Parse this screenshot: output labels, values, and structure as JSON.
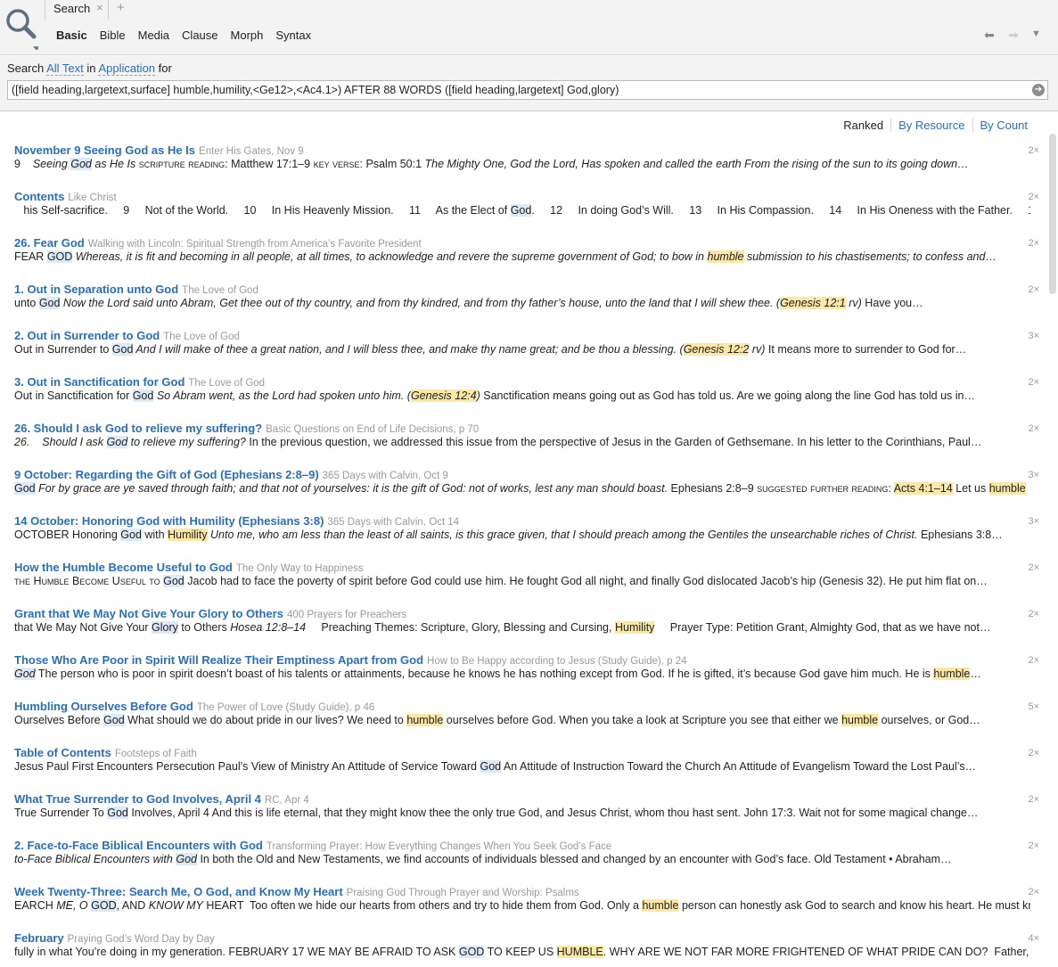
{
  "header": {
    "tab_label": "Search",
    "tab_close": "×",
    "tab_add": "+",
    "modes": [
      "Basic",
      "Bible",
      "Media",
      "Clause",
      "Morph",
      "Syntax"
    ],
    "active_mode": "Basic"
  },
  "query": {
    "prefix": "Search",
    "scope": "All Text",
    "mid": "in",
    "location": "Application",
    "suffix": "for",
    "text": "([field heading,largetext,surface] humble,humility,<Ge12>,<Ac4.1>) AFTER 88 WORDS ([field heading,largetext] God,glory)"
  },
  "sort": [
    "Ranked",
    "By Resource",
    "By Count"
  ],
  "colors": {
    "link": "#2a6ebb",
    "match_green": "#dce9f7",
    "match_yellow": "#fbe8a6"
  },
  "results": [
    {
      "title": "November 9  Seeing God as He Is",
      "source": "Enter His Gates, Nov 9",
      "count": "2×",
      "snippet": [
        [
          "n",
          "9    "
        ],
        [
          "i",
          "Seeing "
        ],
        [
          "ig",
          "God"
        ],
        [
          "i",
          " as He Is "
        ],
        [
          "sc",
          "scripture reading:"
        ],
        [
          "n",
          " Matthew 17:1–9 "
        ],
        [
          "sc",
          "key verse:"
        ],
        [
          "n",
          " Psalm 50:1 "
        ],
        [
          "i",
          "The Mighty One, God the Lord, Has spoken and called the earth From the rising of the sun to its going down…"
        ]
      ]
    },
    {
      "title": "Contents",
      "source": "Like Christ",
      "count": "2×",
      "snippet": [
        [
          "n",
          "   his Self-sacrifice.     9     Not of the World.     10     In His Heavenly Mission.     11     As the Elect of "
        ],
        [
          "g",
          "God"
        ],
        [
          "n",
          ".     12     In doing God’s Will.     13     In His Compassion.     14     In His Oneness with the Father.     15     In…"
        ]
      ]
    },
    {
      "title": "26. Fear God",
      "source": "Walking with Lincoln: Spiritual Strength from America’s Favorite President",
      "count": "2×",
      "snippet": [
        [
          "n",
          "FEAR "
        ],
        [
          "g",
          "GOD"
        ],
        [
          "i",
          " Whereas, it is fit and becoming in all people, at all times, to acknowledge and revere the supreme government of God; to bow in "
        ],
        [
          "iy",
          "humble"
        ],
        [
          "i",
          " submission to his chastisements; to confess and…"
        ]
      ]
    },
    {
      "title": "1. Out in Separation unto God",
      "source": "The Love of God",
      "count": "2×",
      "snippet": [
        [
          "n",
          "unto "
        ],
        [
          "g",
          "God"
        ],
        [
          "i",
          " Now the Lord said unto Abram, Get thee out of thy country, and from thy kindred, and from thy father’s house, unto the land that I will shew thee. ("
        ],
        [
          "iy",
          "Genesis 12:1"
        ],
        [
          "i",
          " rv)"
        ],
        [
          "n",
          " Have you…"
        ]
      ]
    },
    {
      "title": "2. Out in Surrender to God",
      "source": "The Love of God",
      "count": "3×",
      "snippet": [
        [
          "n",
          "Out in Surrender to "
        ],
        [
          "g",
          "God"
        ],
        [
          "i",
          " And I will make of thee a great nation, and I will bless thee, and make thy name great; and be thou a blessing. ("
        ],
        [
          "iy",
          "Genesis 12:2"
        ],
        [
          "i",
          " rv)"
        ],
        [
          "n",
          " It means more to surrender to God for…"
        ]
      ]
    },
    {
      "title": "3. Out in Sanctification for God",
      "source": "The Love of God",
      "count": "2×",
      "snippet": [
        [
          "n",
          "Out in Sanctification for "
        ],
        [
          "g",
          "God"
        ],
        [
          "i",
          " So Abram went, as the Lord had spoken unto him. ("
        ],
        [
          "iy",
          "Genesis 12:4"
        ],
        [
          "i",
          ")"
        ],
        [
          "n",
          " Sanctification means going out as God has told us. Are we going along the line God has told us in…"
        ]
      ]
    },
    {
      "title": " 26. Should I ask God to relieve my suffering?",
      "source": "Basic Questions on End of Life Decisions, p 70",
      "count": "2×",
      "snippet": [
        [
          "i",
          "26.    Should I ask "
        ],
        [
          "ig",
          "God"
        ],
        [
          "i",
          " to relieve my suffering?"
        ],
        [
          "n",
          " In the previous question, we addressed this issue from the perspective of Jesus in the Garden of Gethsemane. In his letter to the Corinthians, Paul…"
        ]
      ]
    },
    {
      "title": "9 October: Regarding the Gift of God (Ephesians 2:8–9)",
      "source": "365 Days with Calvin, Oct 9",
      "count": "3×",
      "snippet": [
        [
          "g",
          "God"
        ],
        [
          "i",
          " For by grace are ye saved through faith; and that not of yourselves: it is the gift of God: not of works, lest any man should boast."
        ],
        [
          "n",
          " Ephesians 2:8–9 "
        ],
        [
          "sc",
          "suggested further reading:"
        ],
        [
          "n",
          " "
        ],
        [
          "y",
          "Acts 4:1–14"
        ],
        [
          "n",
          " Let us "
        ],
        [
          "y",
          "humble"
        ]
      ]
    },
    {
      "title": "14 October: Honoring God with Humility (Ephesians 3:8)",
      "source": "365 Days with Calvin, Oct 14",
      "count": "3×",
      "snippet": [
        [
          "n",
          "OCTOBER Honoring "
        ],
        [
          "g",
          "God"
        ],
        [
          "n",
          " with "
        ],
        [
          "y",
          "Humility"
        ],
        [
          "i",
          " Unto me, who am less than the least of all saints, is this grace given, that I should preach among the Gentiles the unsearchable riches of Christ."
        ],
        [
          "n",
          " Ephesians 3:8…"
        ]
      ]
    },
    {
      "title": "How the Humble Become Useful to God",
      "source": "The Only Way to Happiness",
      "count": "2×",
      "snippet": [
        [
          "sc",
          "the Humble Become Useful to "
        ],
        [
          "g",
          "God"
        ],
        [
          "n",
          " Jacob had to face the poverty of spirit before God could use him. He fought God all night, and finally God dislocated Jacob’s hip (Genesis 32). He put him flat on…"
        ]
      ]
    },
    {
      "title": "Grant that We May Not Give Your Glory to Others",
      "source": "400 Prayers for Preachers",
      "count": "2×",
      "snippet": [
        [
          "n",
          "that We May Not Give Your "
        ],
        [
          "g",
          "Glory"
        ],
        [
          "n",
          " to Others "
        ],
        [
          "i",
          "Hosea 12:8–14"
        ],
        [
          "n",
          "     Preaching Themes: Scripture, Glory, Blessing and Cursing, "
        ],
        [
          "y",
          "Humility"
        ],
        [
          "n",
          "     Prayer Type: Petition Grant, Almighty God, that as we have not…"
        ]
      ]
    },
    {
      "title": "Those Who Are Poor in Spirit Will Realize Their Emptiness Apart from God",
      "source": "How to Be Happy according to Jesus (Study Guide), p 24",
      "count": "2×",
      "snippet": [
        [
          "ig",
          "God"
        ],
        [
          "n",
          " The person who is poor in spirit doesn’t boast of his talents or attainments, because he knows he has nothing except from God. If he is gifted, it’s because God gave him much. He is "
        ],
        [
          "y",
          "humble"
        ],
        [
          "n",
          "…"
        ]
      ]
    },
    {
      "title": "Humbling Ourselves Before God",
      "source": "The Power of Love (Study Guide), p 46",
      "count": "5×",
      "snippet": [
        [
          "n",
          "Ourselves Before "
        ],
        [
          "g",
          "God"
        ],
        [
          "n",
          " What should we do about pride in our lives? We need to "
        ],
        [
          "y",
          "humble"
        ],
        [
          "n",
          " ourselves before God. When you take a look at Scripture you see that either we "
        ],
        [
          "y",
          "humble"
        ],
        [
          "n",
          " ourselves, or God…"
        ]
      ]
    },
    {
      "title": "Table of Contents",
      "source": "Footsteps of Faith",
      "count": "2×",
      "snippet": [
        [
          "n",
          "Jesus Paul First Encounters Persecution Paul’s View of Ministry An Attitude of Service Toward "
        ],
        [
          "g",
          "God"
        ],
        [
          "n",
          " An Attitude of Instruction Toward the Church An Attitude of Evangelism Toward the Lost Paul’s…"
        ]
      ]
    },
    {
      "title": "What True Surrender to God Involves, April 4",
      "source": "RC, Apr 4",
      "count": "2×",
      "snippet": [
        [
          "n",
          "True Surrender To "
        ],
        [
          "g",
          "God"
        ],
        [
          "n",
          " Involves, April 4 And this is life eternal, that they might know thee the only true God, and Jesus Christ, whom thou hast sent. John 17:3. Wait not for some magical change…"
        ]
      ]
    },
    {
      "title": "2. Face-to-Face Biblical Encounters with  God",
      "source": "Transforming Prayer: How Everything Changes When You Seek God’s Face",
      "count": "2×",
      "snippet": [
        [
          "i",
          "to-Face Biblical Encounters with "
        ],
        [
          "ig",
          "God"
        ],
        [
          "n",
          " In both the Old and New Testaments, we find accounts of individuals blessed and changed by an encounter with God’s face. Old Testament • Abraham…"
        ]
      ]
    },
    {
      "title": "Week Twenty-Three: Search Me, O God, and Know My Heart",
      "source": "Praising God Through Prayer and Worship: Psalms",
      "count": "2×",
      "snippet": [
        [
          "n",
          "EARCH "
        ],
        [
          "i",
          "ME, O "
        ],
        [
          "g",
          "GOD"
        ],
        [
          "n",
          ", AND "
        ],
        [
          "i",
          "KNOW MY"
        ],
        [
          "n",
          " HEART  Too often we hide our hearts from others and try to hide them from God. Only a "
        ],
        [
          "y",
          "humble"
        ],
        [
          "n",
          " person can honestly ask God to search and know his heart. He must know God…"
        ]
      ]
    },
    {
      "title": "February",
      "source": "Praying God’s Word Day by Day",
      "count": "4×",
      "snippet": [
        [
          "n",
          "fully in what You’re doing in my generation. FEBRUARY 17 WE MAY BE AFRAID TO ASK "
        ],
        [
          "g",
          "GOD"
        ],
        [
          "n",
          " TO KEEP US "
        ],
        [
          "y",
          "HUMBLE"
        ],
        [
          "n",
          ". WHY ARE WE NOT FAR MORE FRIGHTENED OF WHAT PRIDE CAN DO?  Father, according to…"
        ]
      ]
    }
  ]
}
